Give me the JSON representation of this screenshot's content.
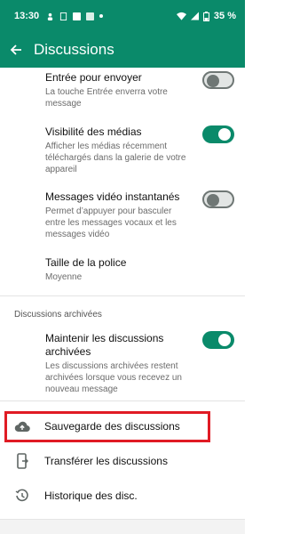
{
  "status": {
    "time": "13:30",
    "battery": "35 %"
  },
  "appbar": {
    "title": "Discussions"
  },
  "settings": [
    {
      "title": "Entrée pour envoyer",
      "subtitle": "La touche Entrée enverra votre message",
      "toggle": false
    },
    {
      "title": "Visibilité des médias",
      "subtitle": "Afficher les médias récemment téléchargés dans la galerie de votre appareil",
      "toggle": true
    },
    {
      "title": "Messages vidéo instantanés",
      "subtitle": "Permet d’appuyer pour basculer entre les messages vocaux et les messages vidéo",
      "toggle": false
    },
    {
      "title": "Taille de la police",
      "subtitle": "Moyenne"
    }
  ],
  "archived": {
    "section_label": "Discussions archivées",
    "title": "Maintenir les discussions archivées",
    "subtitle": "Les discussions archivées restent archivées lorsque vous recevez un nouveau message",
    "toggle": true
  },
  "actions": [
    {
      "label": "Sauvegarde des discussions",
      "icon": "cloud-upload-icon"
    },
    {
      "label": "Transférer les discussions",
      "icon": "phone-transfer-icon"
    },
    {
      "label": "Historique des disc.",
      "icon": "history-icon"
    }
  ],
  "colors": {
    "primary": "#0a8a6a",
    "highlight": "#e01b24"
  }
}
